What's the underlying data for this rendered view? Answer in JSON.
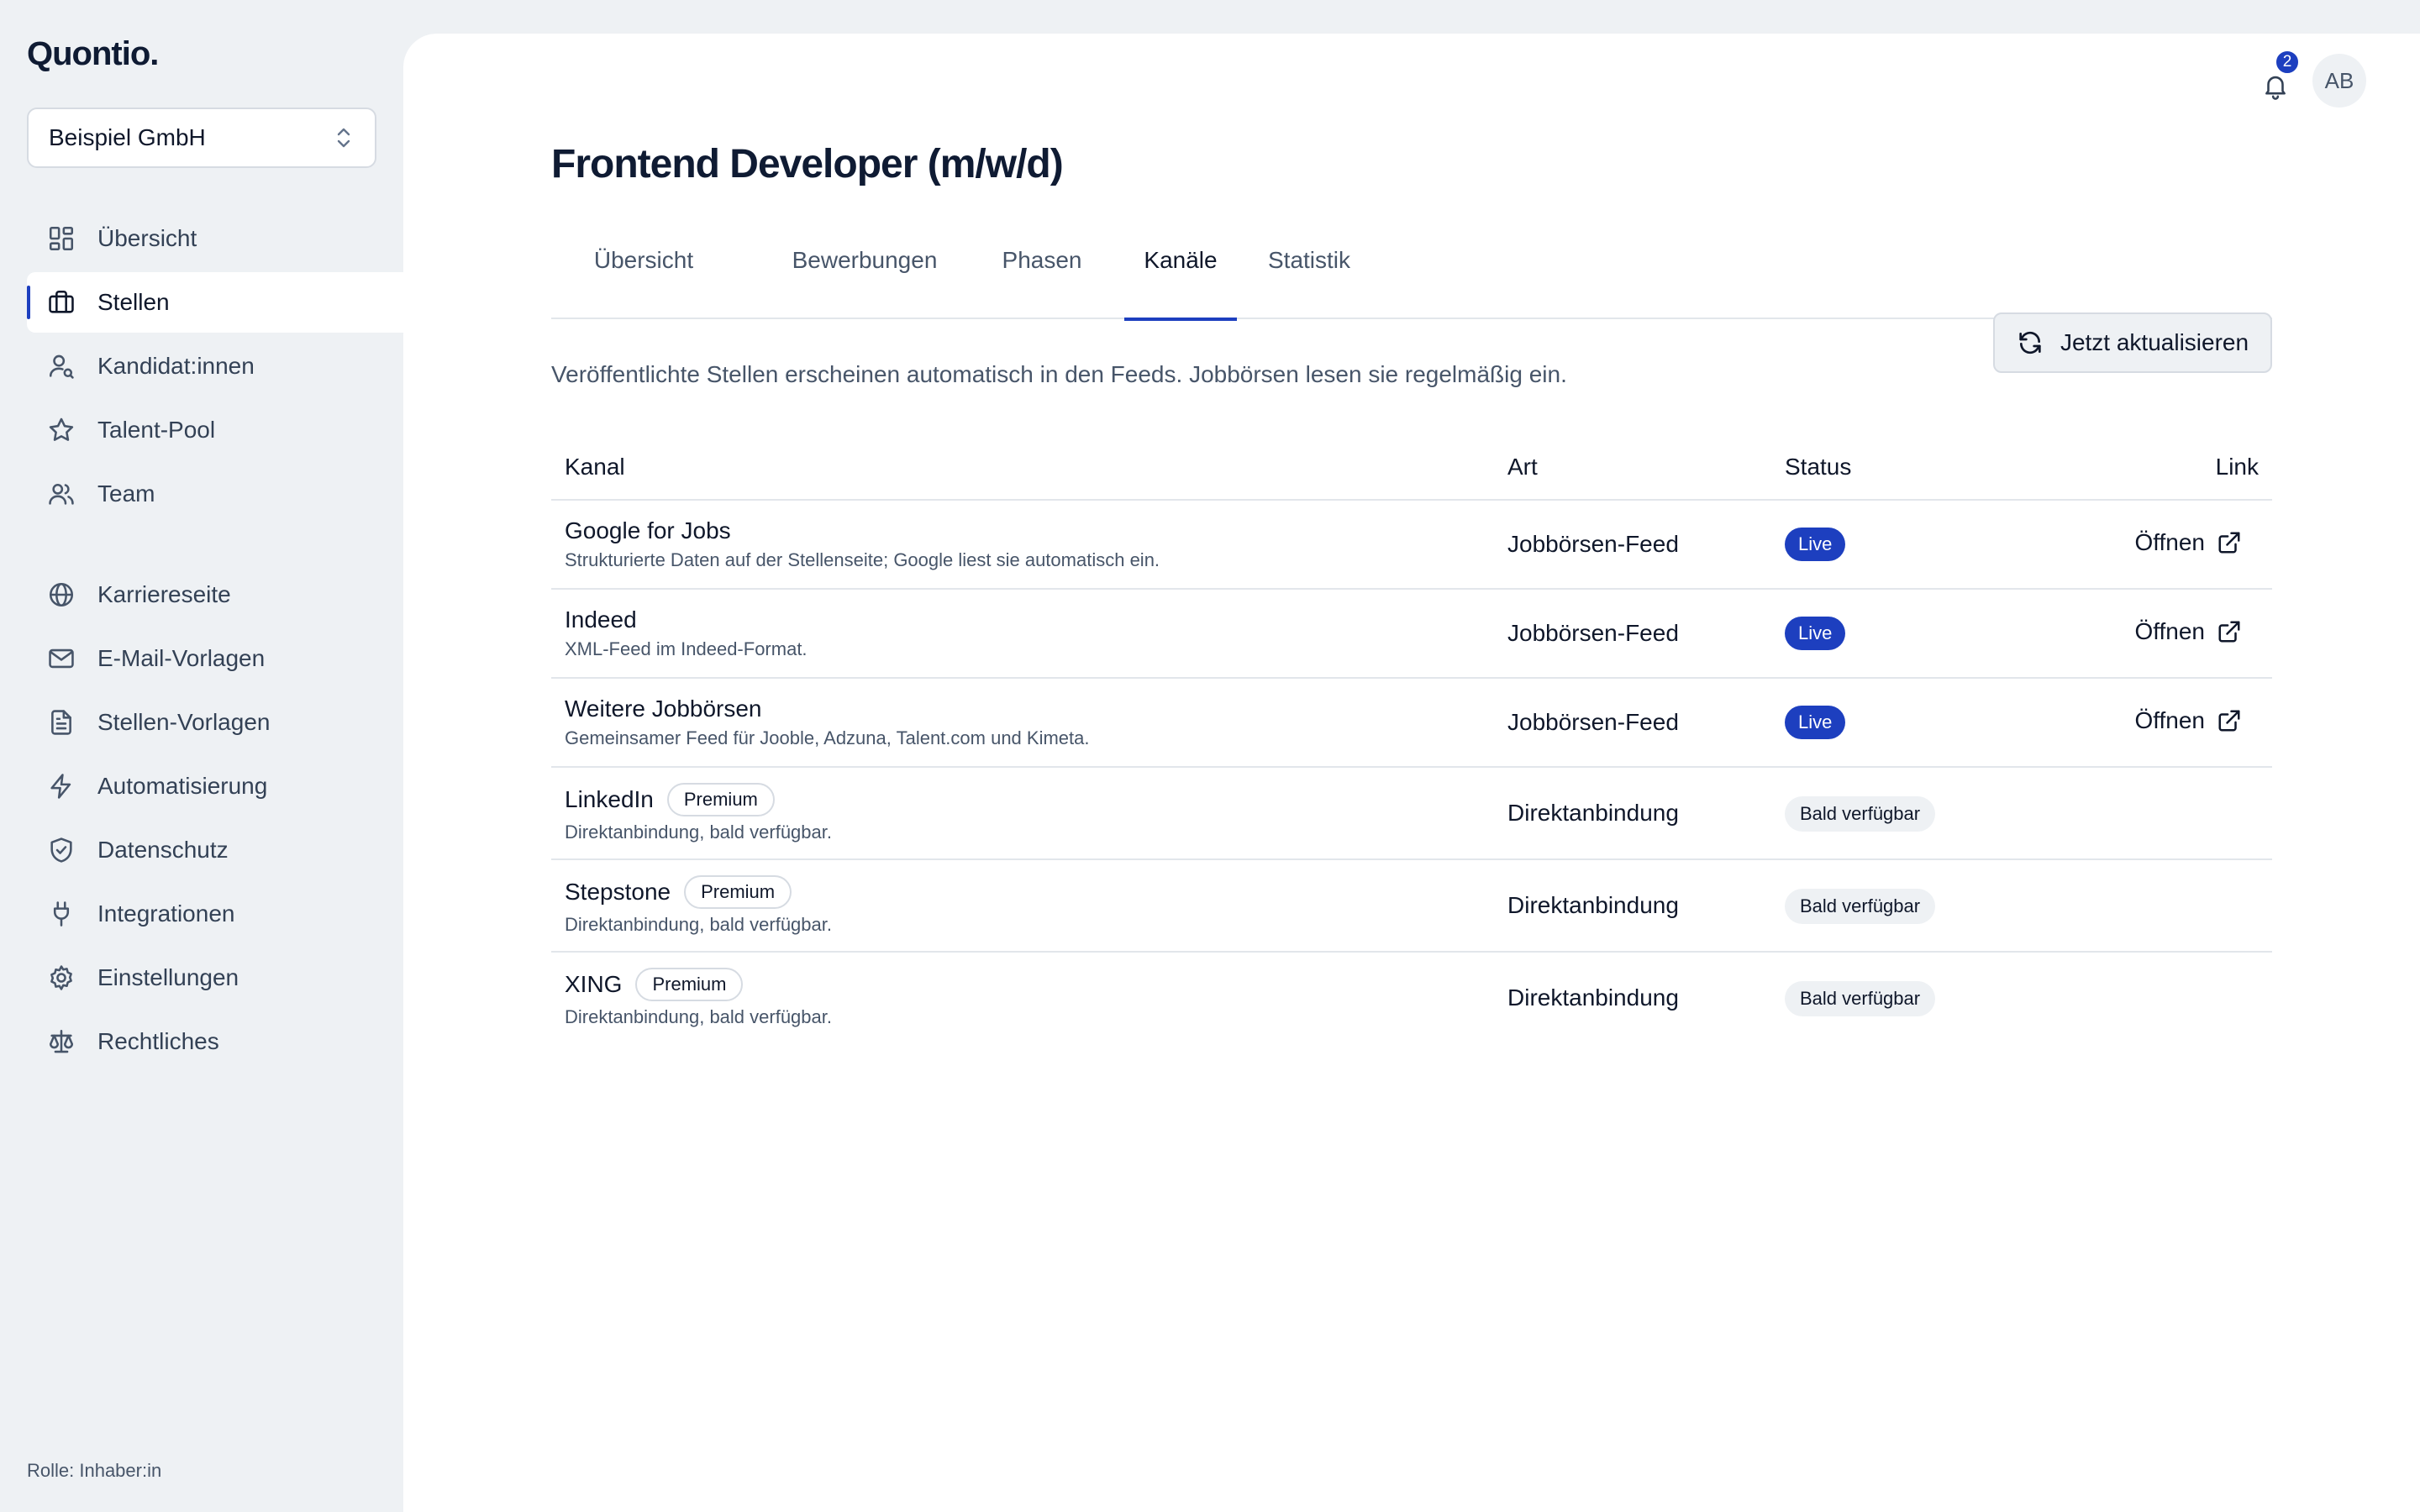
{
  "app": {
    "logo": "Quontio."
  },
  "org_switcher": {
    "name": "Beispiel GmbH"
  },
  "sidebar": {
    "items": [
      {
        "label": "Übersicht",
        "icon": "dashboard-icon"
      },
      {
        "label": "Stellen",
        "icon": "briefcase-icon",
        "active": true
      },
      {
        "label": "Kandidat:innen",
        "icon": "user-search-icon"
      },
      {
        "label": "Talent-Pool",
        "icon": "star-icon"
      },
      {
        "label": "Team",
        "icon": "users-icon"
      },
      {
        "label": "Karriereseite",
        "icon": "globe-icon"
      },
      {
        "label": "E-Mail-Vorlagen",
        "icon": "mail-icon"
      },
      {
        "label": "Stellen-Vorlagen",
        "icon": "file-text-icon"
      },
      {
        "label": "Automatisierung",
        "icon": "lightning-icon"
      },
      {
        "label": "Datenschutz",
        "icon": "shield-check-icon"
      },
      {
        "label": "Integrationen",
        "icon": "plug-icon"
      },
      {
        "label": "Einstellungen",
        "icon": "gear-icon"
      },
      {
        "label": "Rechtliches",
        "icon": "scale-icon"
      }
    ],
    "role": "Rolle: Inhaber:in"
  },
  "header": {
    "notifications_count": "2",
    "avatar_initials": "AB"
  },
  "page": {
    "title": "Frontend Developer (m/w/d)",
    "tabs": [
      {
        "label": "Übersicht"
      },
      {
        "label": "Bewerbungen"
      },
      {
        "label": "Phasen"
      },
      {
        "label": "Kanäle",
        "active": true
      },
      {
        "label": "Statistik"
      }
    ],
    "info": "Veröffentlichte Stellen erscheinen automatisch in den Feeds. Jobbörsen lesen sie regelmäßig ein.",
    "refresh_label": "Jetzt aktualisieren"
  },
  "table": {
    "headers": {
      "channel": "Kanal",
      "type": "Art",
      "status": "Status",
      "link": "Link"
    },
    "rows": [
      {
        "name": "Google for Jobs",
        "desc": "Strukturierte Daten auf der Stellenseite; Google liest sie automatisch ein.",
        "type": "Jobbörsen-Feed",
        "status": "Live",
        "link": "Öffnen"
      },
      {
        "name": "Indeed",
        "desc": "XML-Feed im Indeed-Format.",
        "type": "Jobbörsen-Feed",
        "status": "Live",
        "link": "Öffnen"
      },
      {
        "name": "Weitere Jobbörsen",
        "desc": "Gemeinsamer Feed für Jooble, Adzuna, Talent.com und Kimeta.",
        "type": "Jobbörsen-Feed",
        "status": "Live",
        "link": "Öffnen"
      },
      {
        "name": "LinkedIn",
        "premium": "Premium",
        "desc": "Direktanbindung, bald verfügbar.",
        "type": "Direktanbindung",
        "status": "Bald verfügbar"
      },
      {
        "name": "Stepstone",
        "premium": "Premium",
        "desc": "Direktanbindung, bald verfügbar.",
        "type": "Direktanbindung",
        "status": "Bald verfügbar"
      },
      {
        "name": "XING",
        "premium": "Premium",
        "desc": "Direktanbindung, bald verfügbar.",
        "type": "Direktanbindung",
        "status": "Bald verfügbar"
      }
    ]
  },
  "colors": {
    "accent": "#1d3fbf",
    "sidebar_bg": "#eef1f4",
    "text": "#0f172a",
    "muted": "#475569"
  }
}
